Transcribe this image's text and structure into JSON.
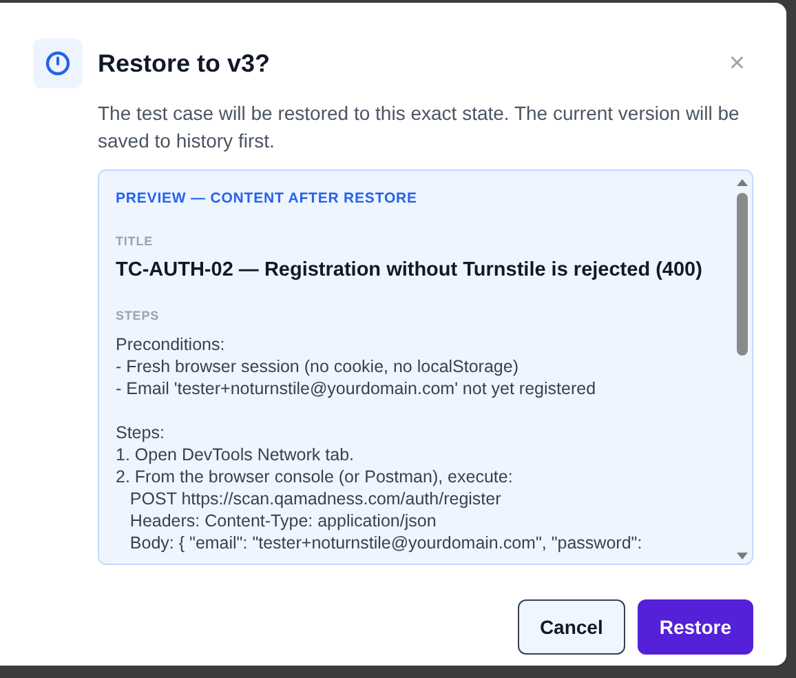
{
  "dialog": {
    "title": "Restore to v3?",
    "close": "×",
    "description": "The test case will be restored to this exact state. The current version will be saved to history first.",
    "preview": {
      "heading": "PREVIEW — CONTENT AFTER RESTORE",
      "title_label": "TITLE",
      "title": "TC-AUTH-02 — Registration without Turnstile is rejected (400)",
      "steps_label": "STEPS",
      "steps_blocks": [
        [
          "Preconditions:",
          "- Fresh browser session (no cookie, no localStorage)",
          "- Email 'tester+noturnstile@yourdomain.com' not yet registered"
        ],
        [
          "Steps:",
          "1. Open DevTools Network tab.",
          "2. From the browser console (or Postman), execute:",
          "   POST https://scan.qamadness.com/auth/register",
          "   Headers: Content-Type: application/json",
          "   Body: { \"email\": \"tester+noturnstile@yourdomain.com\", \"password\":"
        ]
      ]
    },
    "buttons": [
      {
        "label": "Cancel",
        "kind": "secondary"
      },
      {
        "label": "Restore",
        "kind": "primary"
      }
    ]
  }
}
